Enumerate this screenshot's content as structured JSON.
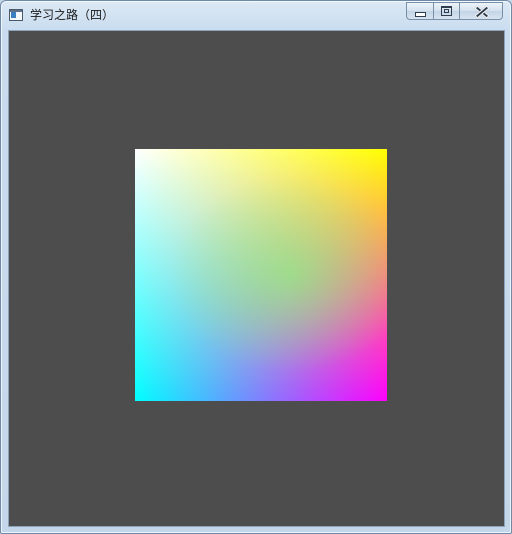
{
  "window": {
    "title": "学习之路（四）"
  },
  "controls": {
    "minimize_icon": "minimize-icon",
    "maximize_icon": "maximize-icon",
    "close_icon": "close-icon"
  },
  "canvas": {
    "background_color": "#4d4d4d",
    "quad_corner_colors": {
      "top_left": "#ffffff",
      "top_right": "#ffff00",
      "bottom_left": "#00ffff",
      "bottom_right": "#ff00ff"
    }
  }
}
